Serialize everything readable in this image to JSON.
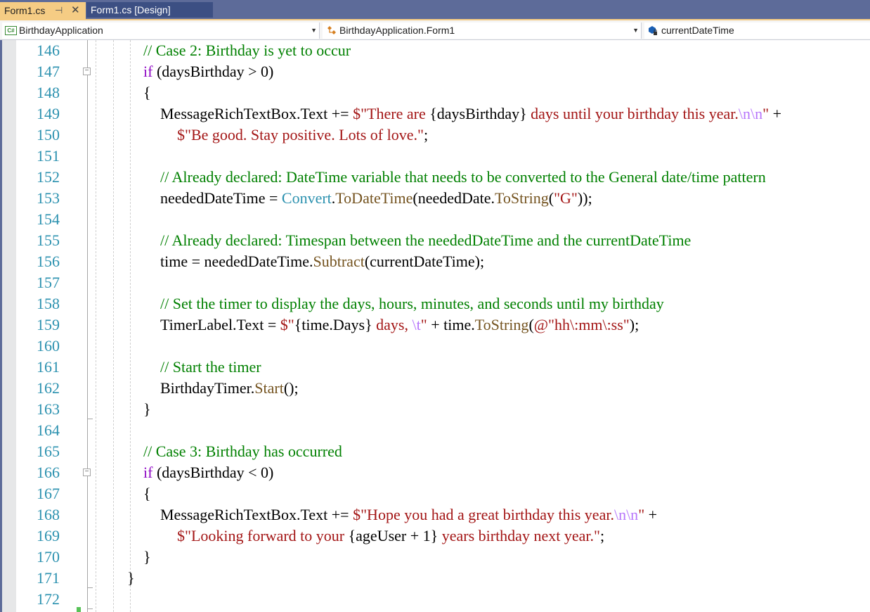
{
  "tabs": [
    {
      "label": "Form1.cs",
      "active": true,
      "pin_icon": "pin-icon",
      "close_icon": "close-icon"
    },
    {
      "label": "Form1.cs [Design]",
      "active": false
    }
  ],
  "navbar": {
    "project": "BirthdayApplication",
    "class": "BirthdayApplication.Form1",
    "member": "currentDateTime",
    "cs_badge": "C#"
  },
  "colors": {
    "comment": "#008000",
    "keyword": "#8f08c4",
    "string": "#a31515",
    "escape": "#b776fb",
    "type": "#2b91af",
    "method": "#74531f",
    "line_number": "#2b91af",
    "tab_active": "#f5cc84",
    "tab_bar": "#5d6b99"
  },
  "fold_glyph": "−",
  "lines": [
    {
      "n": "146",
      "indent": 1,
      "tokens": [
        {
          "t": "// Case 2: Birthday is yet to occur",
          "k": "com"
        }
      ]
    },
    {
      "n": "147",
      "indent": 1,
      "fold": true,
      "tokens": [
        {
          "t": "if",
          "k": "kw"
        },
        {
          "t": " (daysBirthday > 0)",
          "k": "plain"
        }
      ]
    },
    {
      "n": "148",
      "indent": 1,
      "tokens": [
        {
          "t": "{",
          "k": "plain"
        }
      ]
    },
    {
      "n": "149",
      "indent": 2,
      "tokens": [
        {
          "t": "MessageRichTextBox.Text += ",
          "k": "plain"
        },
        {
          "t": "$\"There are ",
          "k": "str"
        },
        {
          "t": "{daysBirthday}",
          "k": "plain"
        },
        {
          "t": " days until your birthday this year.",
          "k": "str"
        },
        {
          "t": "\\n\\n",
          "k": "esc"
        },
        {
          "t": "\"",
          "k": "str"
        },
        {
          "t": " +",
          "k": "plain"
        }
      ]
    },
    {
      "n": "150",
      "indent": 3,
      "tokens": [
        {
          "t": "$\"Be good. Stay positive. Lots of love.\"",
          "k": "str"
        },
        {
          "t": ";",
          "k": "plain"
        }
      ]
    },
    {
      "n": "151",
      "indent": 2,
      "tokens": []
    },
    {
      "n": "152",
      "indent": 2,
      "tokens": [
        {
          "t": "// Already declared: DateTime variable that needs to be converted to the General date/time pattern",
          "k": "com"
        }
      ]
    },
    {
      "n": "153",
      "indent": 2,
      "tokens": [
        {
          "t": "neededDateTime = ",
          "k": "plain"
        },
        {
          "t": "Convert",
          "k": "type"
        },
        {
          "t": ".",
          "k": "plain"
        },
        {
          "t": "ToDateTime",
          "k": "meth"
        },
        {
          "t": "(neededDate.",
          "k": "plain"
        },
        {
          "t": "ToString",
          "k": "meth"
        },
        {
          "t": "(",
          "k": "plain"
        },
        {
          "t": "\"G\"",
          "k": "str"
        },
        {
          "t": "));",
          "k": "plain"
        }
      ]
    },
    {
      "n": "154",
      "indent": 2,
      "tokens": []
    },
    {
      "n": "155",
      "indent": 2,
      "tokens": [
        {
          "t": "// Already declared: Timespan between the neededDateTime and the currentDateTime",
          "k": "com"
        }
      ]
    },
    {
      "n": "156",
      "indent": 2,
      "tokens": [
        {
          "t": "time = neededDateTime.",
          "k": "plain"
        },
        {
          "t": "Subtract",
          "k": "meth"
        },
        {
          "t": "(currentDateTime);",
          "k": "plain"
        }
      ]
    },
    {
      "n": "157",
      "indent": 2,
      "tokens": []
    },
    {
      "n": "158",
      "indent": 2,
      "tokens": [
        {
          "t": "// Set the timer to display the days, hours, minutes, and seconds until my birthday",
          "k": "com"
        }
      ]
    },
    {
      "n": "159",
      "indent": 2,
      "tokens": [
        {
          "t": "TimerLabel.Text = ",
          "k": "plain"
        },
        {
          "t": "$\"",
          "k": "str"
        },
        {
          "t": "{time.Days}",
          "k": "plain"
        },
        {
          "t": " days, ",
          "k": "str"
        },
        {
          "t": "\\t",
          "k": "esc"
        },
        {
          "t": "\"",
          "k": "str"
        },
        {
          "t": " + time.",
          "k": "plain"
        },
        {
          "t": "ToString",
          "k": "meth"
        },
        {
          "t": "(",
          "k": "plain"
        },
        {
          "t": "@\"hh\\:mm\\:ss\"",
          "k": "str"
        },
        {
          "t": ");",
          "k": "plain"
        }
      ]
    },
    {
      "n": "160",
      "indent": 2,
      "tokens": []
    },
    {
      "n": "161",
      "indent": 2,
      "tokens": [
        {
          "t": "// Start the timer",
          "k": "com"
        }
      ]
    },
    {
      "n": "162",
      "indent": 2,
      "tokens": [
        {
          "t": "BirthdayTimer.",
          "k": "plain"
        },
        {
          "t": "Start",
          "k": "meth"
        },
        {
          "t": "();",
          "k": "plain"
        }
      ]
    },
    {
      "n": "163",
      "indent": 1,
      "tokens": [
        {
          "t": "}",
          "k": "plain"
        }
      ]
    },
    {
      "n": "164",
      "indent": 1,
      "tokens": []
    },
    {
      "n": "165",
      "indent": 1,
      "tokens": [
        {
          "t": "// Case 3: Birthday has occurred",
          "k": "com"
        }
      ]
    },
    {
      "n": "166",
      "indent": 1,
      "fold": true,
      "tokens": [
        {
          "t": "if",
          "k": "kw"
        },
        {
          "t": " (daysBirthday < 0)",
          "k": "plain"
        }
      ]
    },
    {
      "n": "167",
      "indent": 1,
      "tokens": [
        {
          "t": "{",
          "k": "plain"
        }
      ]
    },
    {
      "n": "168",
      "indent": 2,
      "tokens": [
        {
          "t": "MessageRichTextBox.Text += ",
          "k": "plain"
        },
        {
          "t": "$\"Hope you had a great birthday this year.",
          "k": "str"
        },
        {
          "t": "\\n\\n",
          "k": "esc"
        },
        {
          "t": "\"",
          "k": "str"
        },
        {
          "t": " +",
          "k": "plain"
        }
      ]
    },
    {
      "n": "169",
      "indent": 3,
      "tokens": [
        {
          "t": "$\"Looking forward to your ",
          "k": "str"
        },
        {
          "t": "{ageUser + 1}",
          "k": "plain"
        },
        {
          "t": " years birthday next year.\"",
          "k": "str"
        },
        {
          "t": ";",
          "k": "plain"
        }
      ]
    },
    {
      "n": "170",
      "indent": 1,
      "tokens": [
        {
          "t": "}",
          "k": "plain"
        }
      ]
    },
    {
      "n": "171",
      "indent": 0,
      "tokens": [
        {
          "t": "}",
          "k": "plain"
        }
      ]
    },
    {
      "n": "172",
      "indent": 0,
      "tokens": []
    }
  ]
}
